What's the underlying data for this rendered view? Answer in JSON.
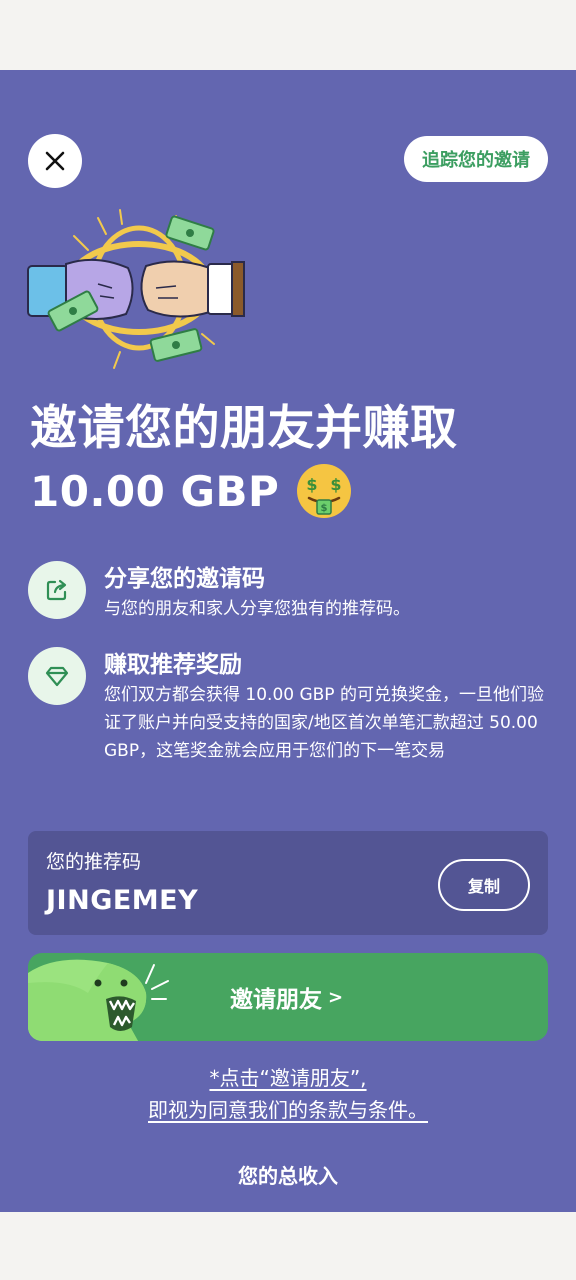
{
  "header": {
    "close_icon": "close-icon",
    "track_label": "追踪您的邀请"
  },
  "hero": {
    "headline": "邀请您的朋友并赚取",
    "amount": "10.00 GBP",
    "emoji": "money-mouth-face"
  },
  "steps": [
    {
      "icon": "share-icon",
      "title": "分享您的邀请码",
      "description": "与您的朋友和家人分享您独有的推荐码。"
    },
    {
      "icon": "gem-icon",
      "title": "赚取推荐奖励",
      "description": "您们双方都会获得 10.00 GBP 的可兑换奖金，一旦他们验证了账户并向受支持的国家/地区首次单笔汇款超过 50.00 GBP，这笔奖金就会应用于您们的下一笔交易"
    }
  ],
  "referral": {
    "label": "您的推荐码",
    "code": "JINGEMEY",
    "copy_label": "复制"
  },
  "invite": {
    "label": "邀请朋友",
    "chevron": ">"
  },
  "terms": {
    "line1": "*点击“邀请朋友”,",
    "line2": "即视为同意我们的条款与条件。"
  },
  "earnings": {
    "title": "您的总收入"
  },
  "colors": {
    "background": "#6366b0",
    "card": "#535594",
    "primary_green": "#47a560",
    "track_text": "#3c9e61",
    "icon_bg": "#e8f6ea"
  }
}
